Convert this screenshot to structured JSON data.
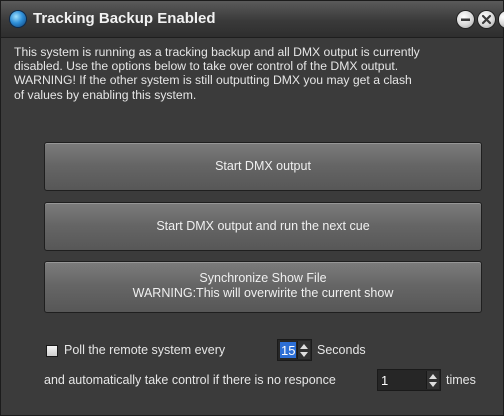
{
  "window": {
    "title": "Tracking Backup Enabled",
    "icon": "app-globe-icon",
    "controls": [
      "minimize-icon",
      "close-icon"
    ]
  },
  "message": {
    "line1": "This system is running as a tracking backup and all DMX output is currently",
    "line2": "disabled. Use the options below to take over control of the DMX output.",
    "line3": "WARNING! If the other system is still outputting DMX you may get a clash",
    "line4": "of values by enabling this system."
  },
  "buttons": {
    "start_output": "Start DMX output",
    "start_output_next_cue": "Start DMX output and run the next cue",
    "sync_line1": "Synchronize Show File",
    "sync_line2": "WARNING:This will overwirite the current show"
  },
  "poll": {
    "checked": false,
    "label": "Poll the remote system every",
    "interval_value": "15",
    "seconds_label": "Seconds",
    "control_label": "and automatically take control  if there is no responce",
    "times_value": "1",
    "times_label": "times"
  },
  "colors": {
    "background": "#3b3b3b",
    "button": "#666666",
    "selection": "#2d6fd6",
    "text": "#e6e6e6"
  }
}
